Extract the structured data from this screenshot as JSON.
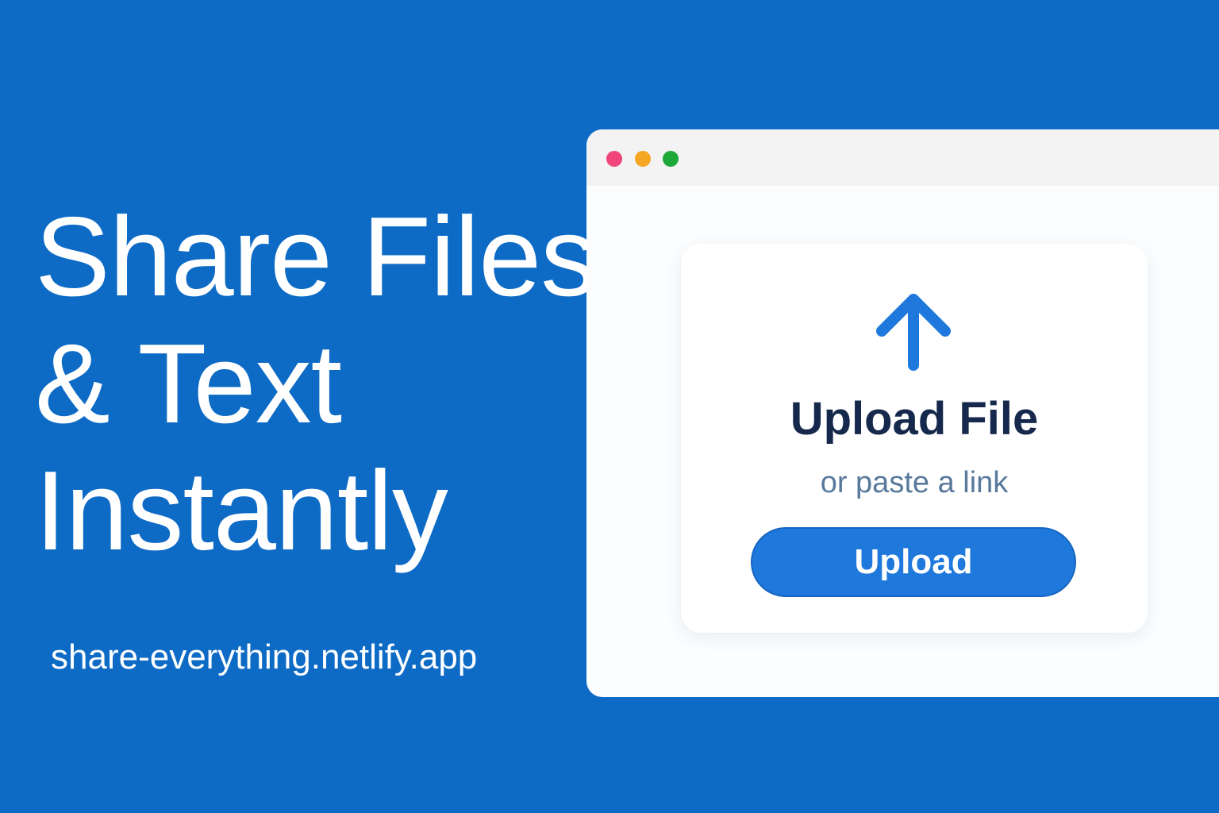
{
  "hero": {
    "headline": [
      "Share Files",
      "& Text",
      "Instantly"
    ],
    "url": "share-everything.netlify.app"
  },
  "window": {
    "controls": [
      "close-dot",
      "minimize-dot",
      "maximize-dot"
    ]
  },
  "upload_card": {
    "icon": "upload-arrow-icon",
    "title": "Upload File",
    "subtitle": "or paste a link",
    "button_label": "Upload"
  },
  "colors": {
    "background": "#0d6bc6",
    "accent": "#1f78dc",
    "title": "#16284b",
    "subtitle": "#58799b",
    "close": "#f0457b",
    "minimize": "#f5a623",
    "maximize": "#1fa83a"
  }
}
